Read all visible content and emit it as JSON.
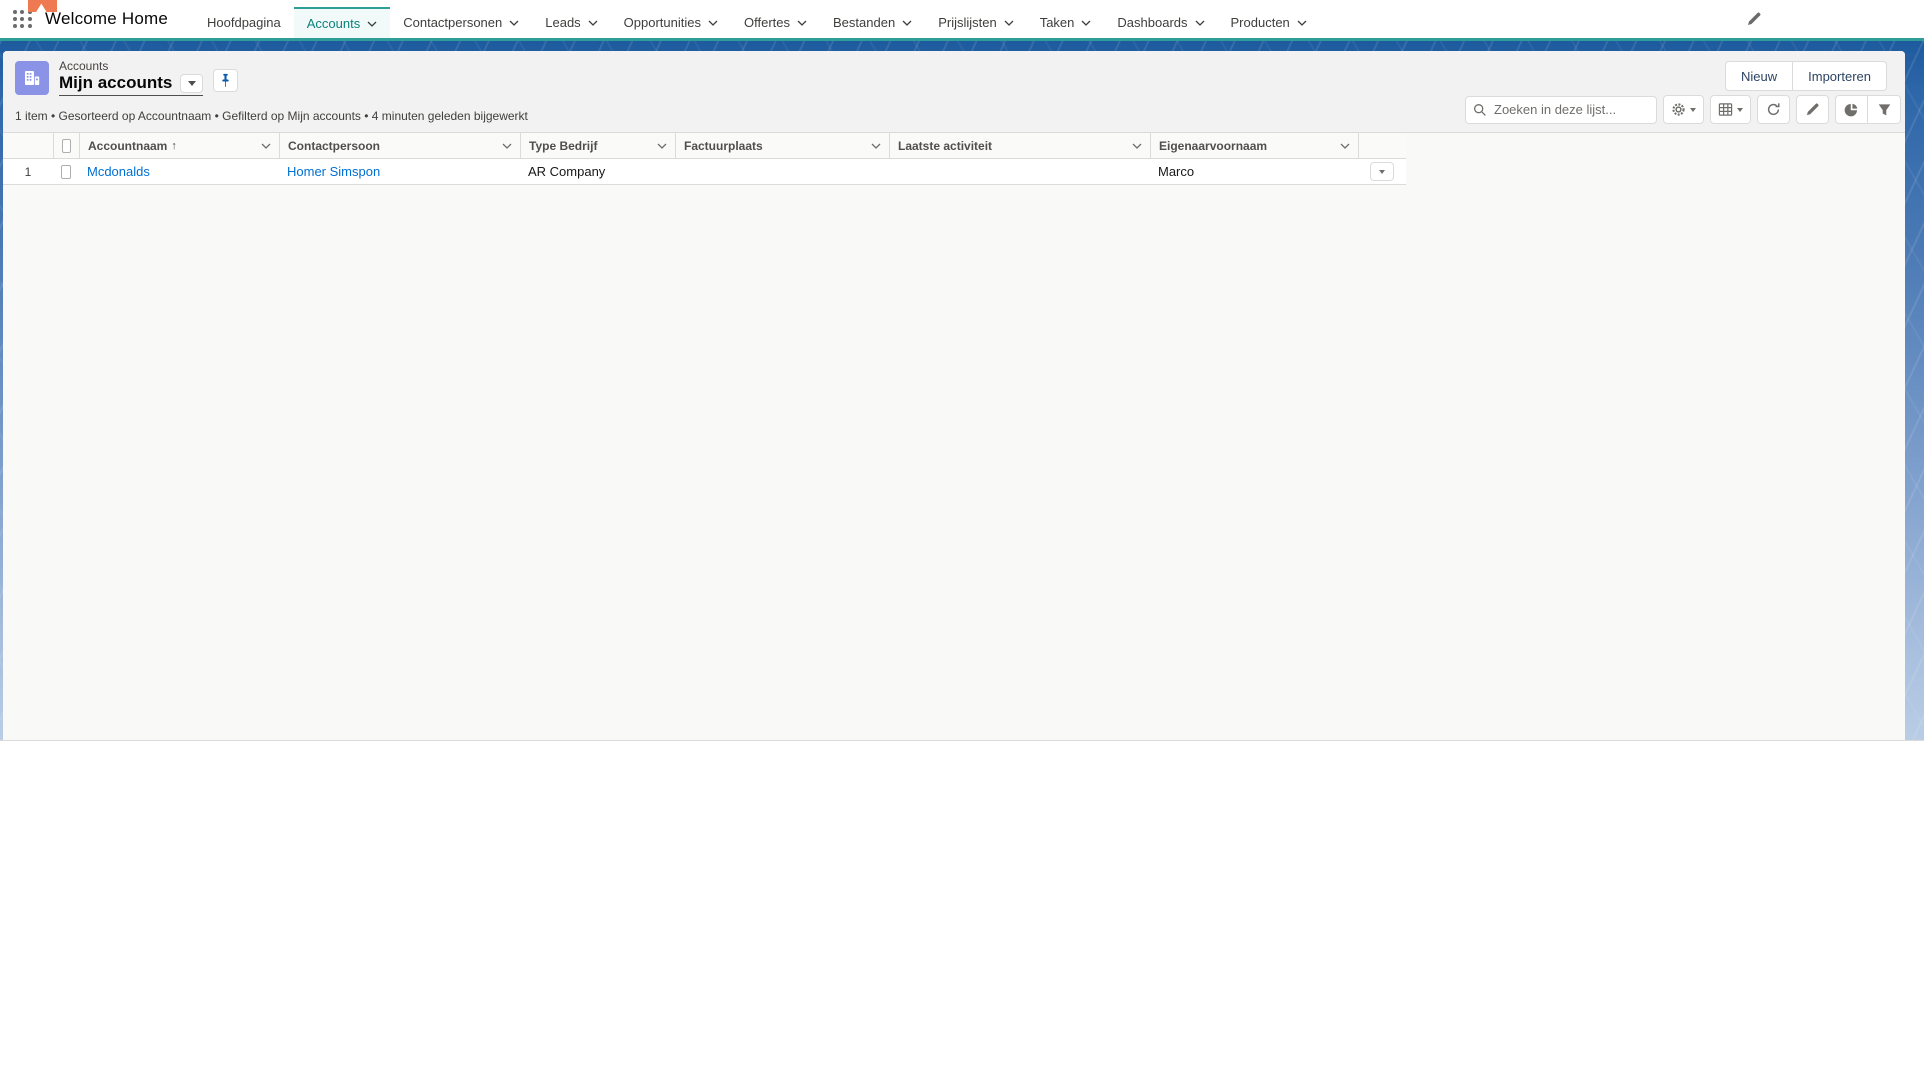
{
  "nav": {
    "app_name": "Welcome Home",
    "tabs": [
      {
        "label": "Hoofdpagina",
        "chevron": false,
        "active": false
      },
      {
        "label": "Accounts",
        "chevron": true,
        "active": true
      },
      {
        "label": "Contactpersonen",
        "chevron": true,
        "active": false
      },
      {
        "label": "Leads",
        "chevron": true,
        "active": false
      },
      {
        "label": "Opportunities",
        "chevron": true,
        "active": false
      },
      {
        "label": "Offertes",
        "chevron": true,
        "active": false
      },
      {
        "label": "Bestanden",
        "chevron": true,
        "active": false
      },
      {
        "label": "Prijslijsten",
        "chevron": true,
        "active": false
      },
      {
        "label": "Taken",
        "chevron": true,
        "active": false
      },
      {
        "label": "Dashboards",
        "chevron": true,
        "active": false
      },
      {
        "label": "Producten",
        "chevron": true,
        "active": false
      }
    ]
  },
  "list_header": {
    "entity_label": "Accounts",
    "list_name": "Mijn accounts",
    "new_button": "Nieuw",
    "import_button": "Importeren",
    "status_line": "1 item • Gesorteerd op Accountnaam • Gefilterd op Mijn accounts • 4 minuten geleden bijgewerkt",
    "search_placeholder": "Zoeken in deze lijst..."
  },
  "table": {
    "columns": [
      "Accountnaam",
      "Contactpersoon",
      "Type Bedrijf",
      "Factuurplaats",
      "Laatste activiteit",
      "Eigenaarvoornaam"
    ],
    "sort_indicator": "↑",
    "sorted_column": "Accountnaam",
    "rows": [
      {
        "num": "1",
        "account_name": "Mcdonalds",
        "contact": "Homer Simspon",
        "type": "AR Company",
        "billing_city": "",
        "last_activity": "",
        "owner_first_name": "Marco"
      }
    ]
  },
  "icons": {
    "app_launcher": "waffle-icon",
    "list_object": "building-icon",
    "pin": "pushpin-icon",
    "search": "magnifier-icon",
    "toolbar": [
      "gear-icon",
      "table-grid-icon",
      "refresh-icon",
      "pencil-icon",
      "pie-chart-icon",
      "funnel-icon"
    ],
    "nav_edit": "pencil-icon"
  },
  "colors": {
    "accent_teal": "#2f9e98",
    "header_band_blue": "#1d5a9e",
    "link_blue": "#0070d2",
    "object_icon_purple": "#8a93e6",
    "card_header_gray": "#f3f2f2"
  }
}
